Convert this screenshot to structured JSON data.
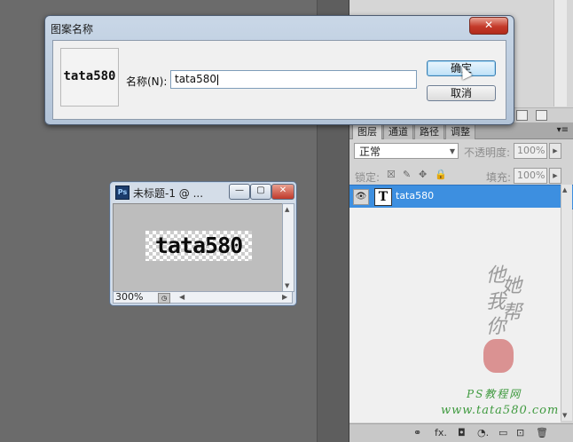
{
  "dialog": {
    "title": "图案名称",
    "close_label": "✕",
    "preview_text": "tata580",
    "name_label": "名称(N):",
    "name_value": "tata580",
    "ok_label": "确定",
    "cancel_label": "取消"
  },
  "document": {
    "ps_badge": "Ps",
    "title": "未标题-1 @ ...",
    "minimize": "—",
    "restore": "▢",
    "close": "✕",
    "canvas_text": "tata580",
    "zoom": "300%"
  },
  "layers_panel": {
    "tabs": [
      "图层",
      "通道",
      "路径",
      "调整"
    ],
    "menu_icon": "▾≡",
    "blend_mode": "正常",
    "opacity_label": "不透明度:",
    "opacity_value": "100%",
    "lock_label": "锁定:",
    "fill_label": "填充:",
    "fill_value": "100%",
    "layer": {
      "thumb": "T",
      "name": "tata580",
      "eye": "👁"
    },
    "bottom_icons": [
      "⚭",
      "fx.",
      "◘",
      "◔.",
      "▭",
      "⊡",
      "🗑"
    ]
  },
  "watermark": {
    "calligraphy": [
      "他",
      "她",
      "我",
      "帮",
      "你"
    ],
    "line1": "PS教程网",
    "line2": "www.tata580.com"
  },
  "colors": {
    "workspace": "#6b6b6b",
    "selected_layer": "#3d8fe0",
    "dialog_frame": "#b2c3d7",
    "close_red": "#c43a2a"
  }
}
